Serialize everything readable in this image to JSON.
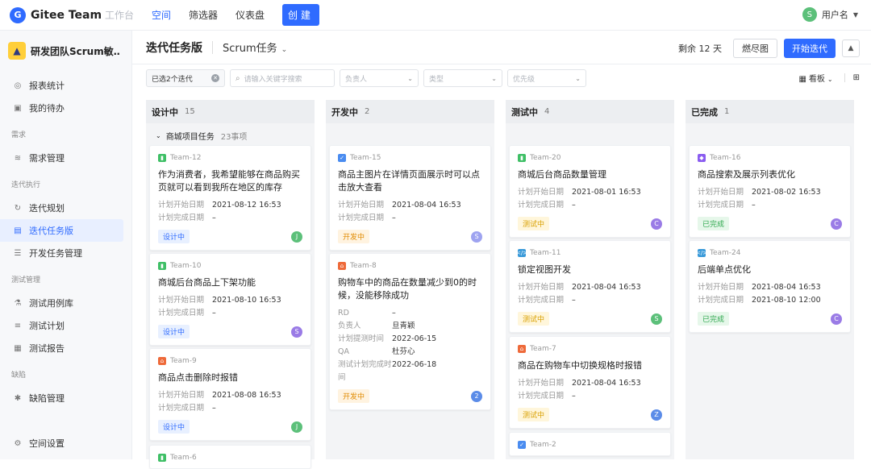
{
  "topbar": {
    "brand": "Gitee Team",
    "nav": [
      "工作台",
      "空间",
      "筛选器",
      "仪表盘"
    ],
    "create_label": "创建",
    "user_initial": "S",
    "user_name": "用户名"
  },
  "sidebar": {
    "project_name": "研发团队Scrum敏…",
    "items_top": [
      {
        "label": "报表统计",
        "icon": "chart-icon"
      },
      {
        "label": "我的待办",
        "icon": "todo-icon"
      }
    ],
    "group_req": "需求",
    "req_items": [
      {
        "label": "需求管理",
        "icon": "layers-icon"
      }
    ],
    "group_iter": "迭代执行",
    "iter_items": [
      {
        "label": "迭代规划",
        "icon": "cycle-icon"
      },
      {
        "label": "迭代任务版",
        "icon": "board-icon"
      },
      {
        "label": "开发任务管理",
        "icon": "list-icon"
      }
    ],
    "group_test": "测试管理",
    "test_items": [
      {
        "label": "测试用例库",
        "icon": "flask-icon"
      },
      {
        "label": "测试计划",
        "icon": "plan-icon"
      },
      {
        "label": "测试报告",
        "icon": "report-icon"
      }
    ],
    "group_bug": "缺陷",
    "bug_items": [
      {
        "label": "缺陷管理",
        "icon": "bug-icon"
      }
    ],
    "settings_label": "空间设置"
  },
  "header": {
    "title": "迭代任务版",
    "subtitle": "Scrum任务",
    "remaining": "剩余 12 天",
    "burndown_label": "燃尽图",
    "start_label": "开始迭代"
  },
  "filters": {
    "selected_iter": "已选2个迭代",
    "search_placeholder": "请输入关键字搜索",
    "assignee": "负责人",
    "type": "类型",
    "priority": "优先级",
    "view": "看板"
  },
  "group": {
    "name": "商城项目任务",
    "count": "23事项"
  },
  "columns": [
    {
      "name": "设计中",
      "count": "15",
      "cards": [
        {
          "id": "Team-12",
          "type": "story",
          "title": "作为消费者，我希望能够在商品购买页就可以看到我所在地区的库存",
          "rows": [
            [
              "计划开始日期",
              "2021-08-12 16:53"
            ],
            [
              "计划完成日期",
              "–"
            ]
          ],
          "tag": "设计中",
          "tag_style": "design",
          "avatar": "J",
          "av_color": "g"
        },
        {
          "id": "Team-10",
          "type": "story",
          "title": "商城后台商品上下架功能",
          "rows": [
            [
              "计划开始日期",
              "2021-08-10 16:53"
            ],
            [
              "计划完成日期",
              "–"
            ]
          ],
          "tag": "设计中",
          "tag_style": "design",
          "avatar": "S",
          "av_color": "p"
        },
        {
          "id": "Team-9",
          "type": "bug",
          "title": "商品点击删除时报错",
          "rows": [
            [
              "计划开始日期",
              "2021-08-08 16:53"
            ],
            [
              "计划完成日期",
              "–"
            ]
          ],
          "tag": "设计中",
          "tag_style": "design",
          "avatar": "J",
          "av_color": "g"
        },
        {
          "id": "Team-6",
          "type": "story",
          "title": "",
          "rows": [],
          "tag": "",
          "tag_style": "design",
          "avatar": "",
          "av_color": "g"
        }
      ]
    },
    {
      "name": "开发中",
      "count": "2",
      "cards": [
        {
          "id": "Team-15",
          "type": "task",
          "title": "商品主图片在详情页面展示时可以点击放大查看",
          "rows": [
            [
              "计划开始日期",
              "2021-08-04 16:53"
            ],
            [
              "计划完成日期",
              "–"
            ]
          ],
          "tag": "开发中",
          "tag_style": "dev",
          "avatar": "S",
          "av_color": "ps"
        },
        {
          "id": "Team-8",
          "type": "bug",
          "title": "购物车中的商品在数量减少到0的时候，没能移除成功",
          "rows": [
            [
              "RD",
              "–"
            ],
            [
              "负责人",
              "旦青颖"
            ],
            [
              "计划提测时间",
              "2022-06-15"
            ],
            [
              "QA",
              "杜芬心"
            ],
            [
              "测试计划完成时间",
              "2022-06-18"
            ]
          ],
          "tag": "开发中",
          "tag_style": "dev",
          "avatar": "2",
          "av_color": "b"
        }
      ]
    },
    {
      "name": "测试中",
      "count": "4",
      "cards": [
        {
          "id": "Team-20",
          "type": "story",
          "title": "商城后台商品数量管理",
          "rows": [
            [
              "计划开始日期",
              "2021-08-01 16:53"
            ],
            [
              "计划完成日期",
              "–"
            ]
          ],
          "tag": "测试中",
          "tag_style": "test",
          "avatar": "C",
          "av_color": "p"
        },
        {
          "id": "Team-11",
          "type": "code",
          "title": "锁定视图开发",
          "rows": [
            [
              "计划开始日期",
              "2021-08-04 16:53"
            ],
            [
              "计划完成日期",
              "–"
            ]
          ],
          "tag": "测试中",
          "tag_style": "test",
          "avatar": "S",
          "av_color": "g"
        },
        {
          "id": "Team-7",
          "type": "bug",
          "title": "商品在购物车中切换规格时报错",
          "rows": [
            [
              "计划开始日期",
              "2021-08-04 16:53"
            ],
            [
              "计划完成日期",
              "–"
            ]
          ],
          "tag": "测试中",
          "tag_style": "test",
          "avatar": "Z",
          "av_color": "b"
        },
        {
          "id": "Team-2",
          "type": "task",
          "title": "",
          "rows": [],
          "tag": "",
          "tag_style": "test",
          "avatar": "",
          "av_color": "g"
        }
      ]
    },
    {
      "name": "已完成",
      "count": "1",
      "cards": [
        {
          "id": "Team-16",
          "type": "feat",
          "title": "商品搜索及展示列表优化",
          "rows": [
            [
              "计划开始日期",
              "2021-08-02 16:53"
            ],
            [
              "计划完成日期",
              "–"
            ]
          ],
          "tag": "已完成",
          "tag_style": "done",
          "avatar": "C",
          "av_color": "p"
        },
        {
          "id": "Team-24",
          "type": "code",
          "title": "后端单点优化",
          "rows": [
            [
              "计划开始日期",
              "2021-08-04 16:53"
            ],
            [
              "计划完成日期",
              "2021-08-10 12:00"
            ]
          ],
          "tag": "已完成",
          "tag_style": "done",
          "avatar": "C",
          "av_color": "p"
        }
      ]
    }
  ]
}
